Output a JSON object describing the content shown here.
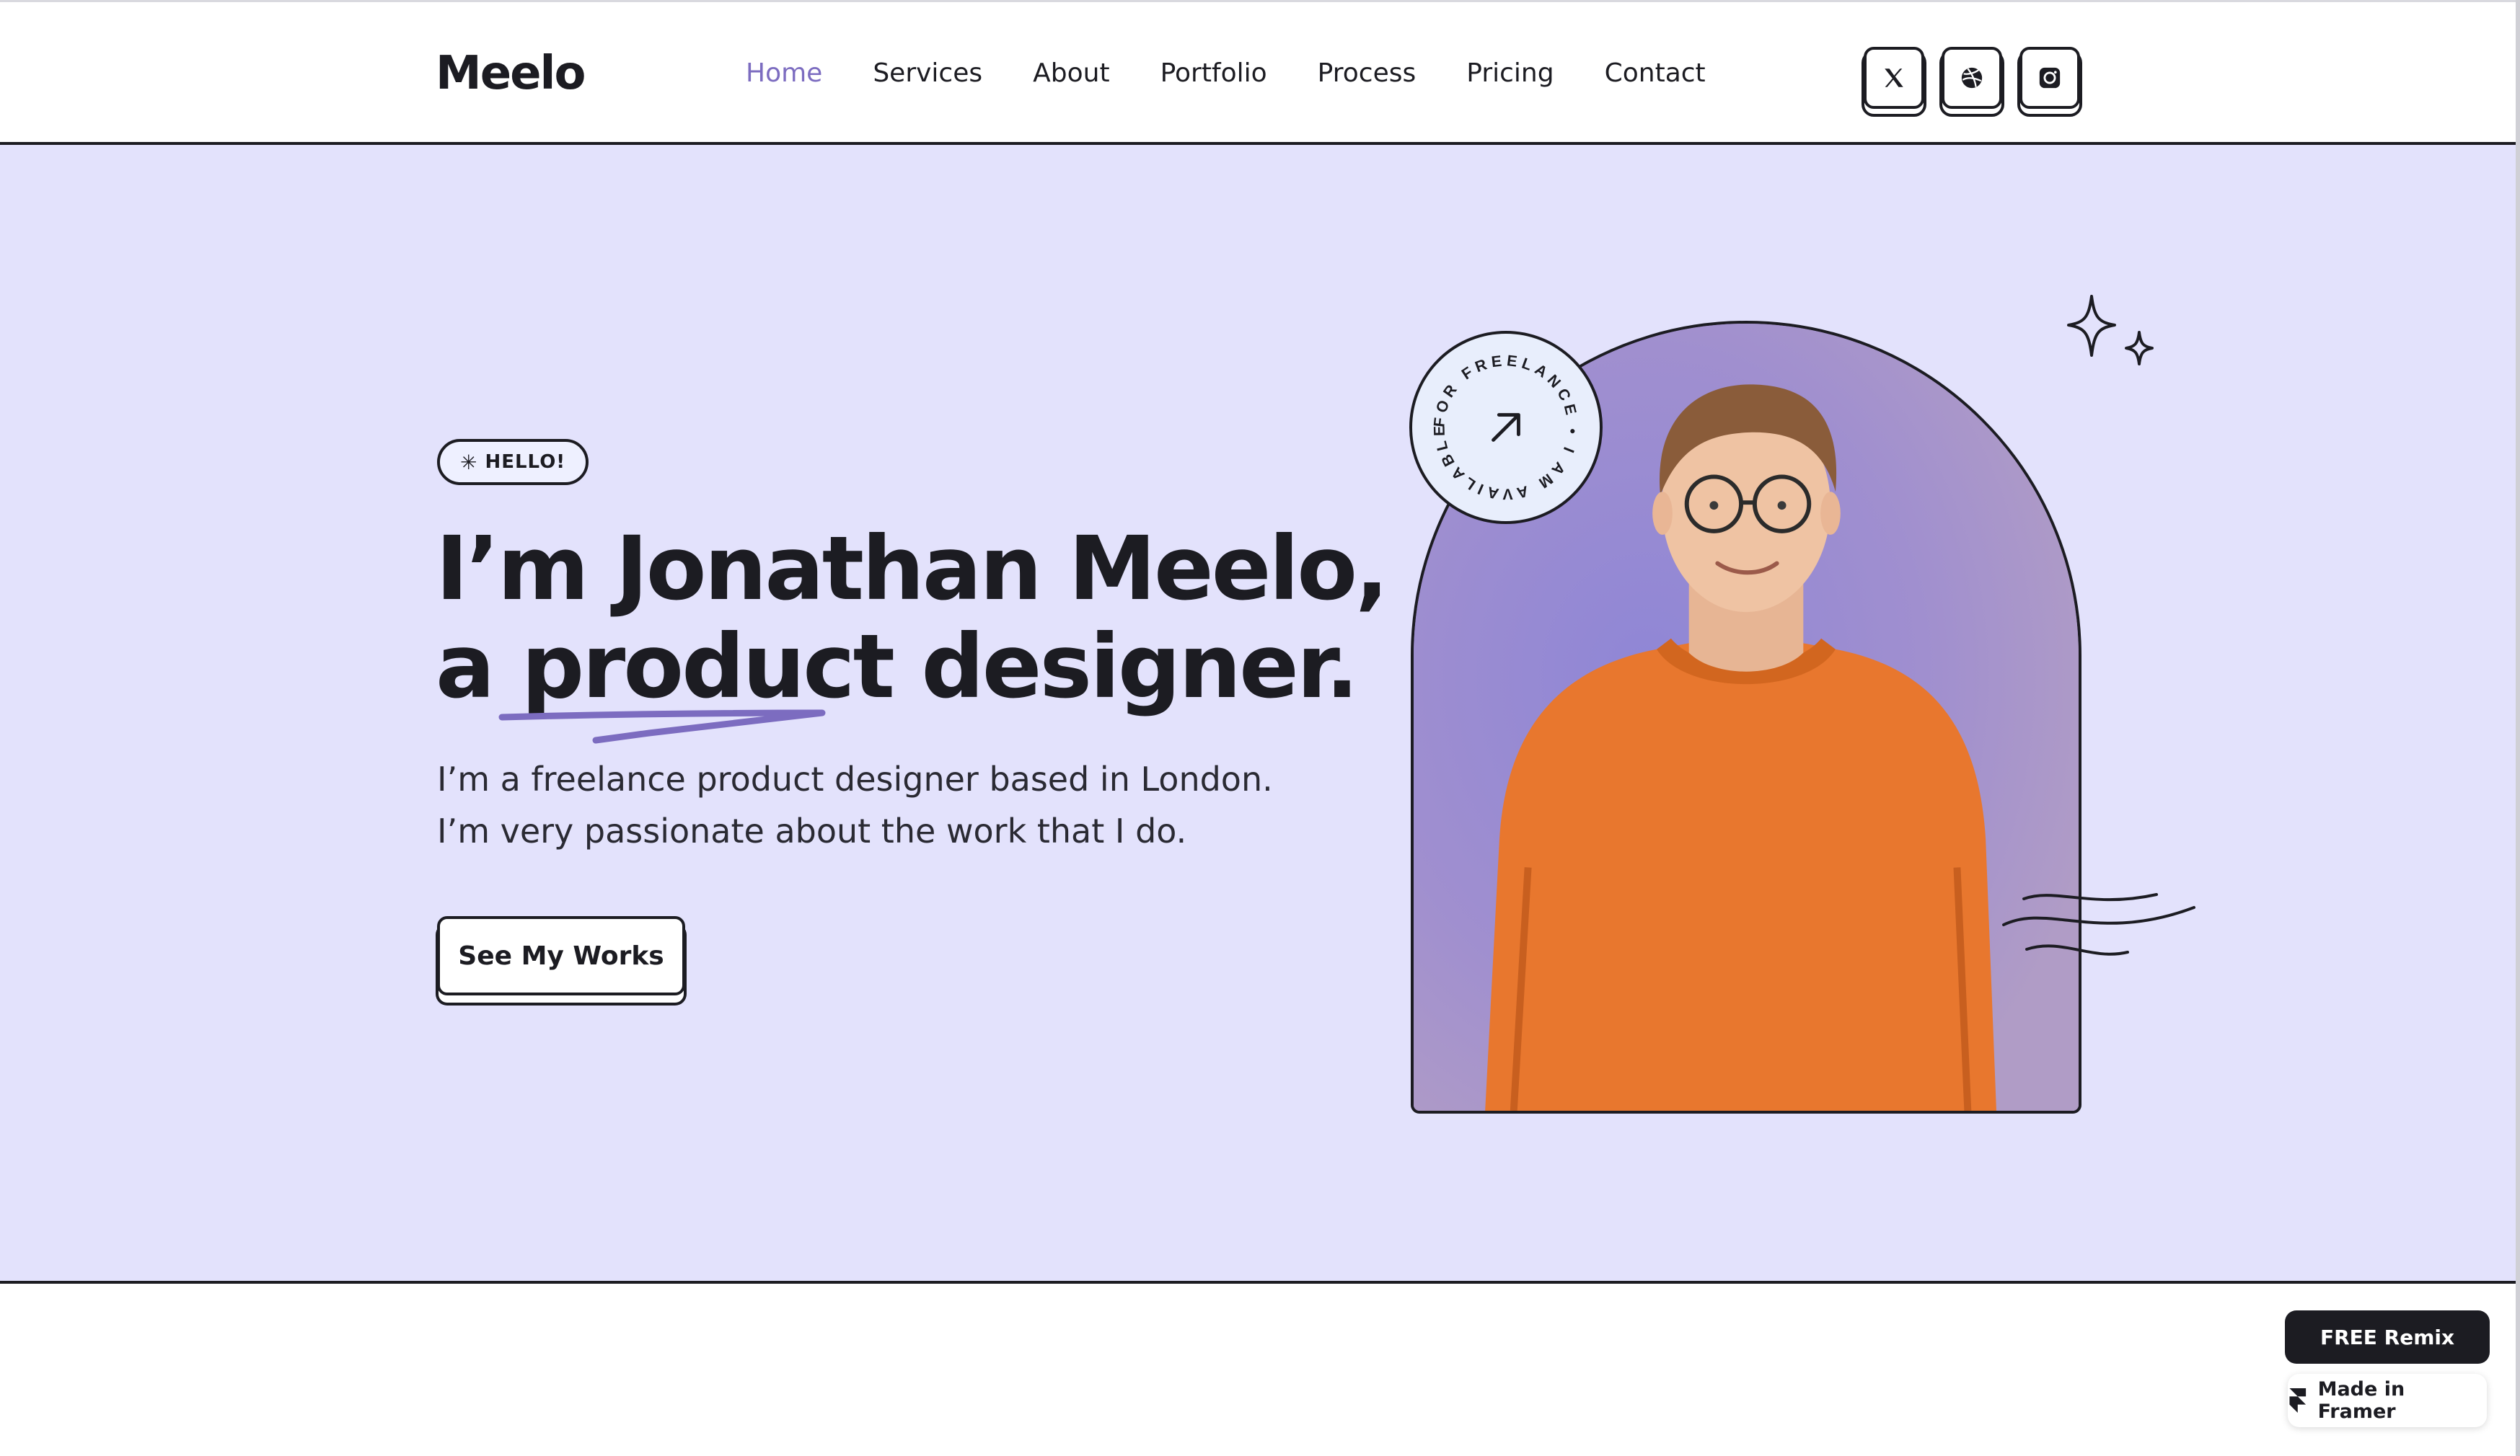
{
  "header": {
    "logo": "Meelo",
    "nav": [
      {
        "label": "Home",
        "active": true
      },
      {
        "label": "Services",
        "active": false
      },
      {
        "label": "About",
        "active": false
      },
      {
        "label": "Portfolio",
        "active": false
      },
      {
        "label": "Process",
        "active": false
      },
      {
        "label": "Pricing",
        "active": false
      },
      {
        "label": "Contact",
        "active": false
      }
    ],
    "socials": [
      {
        "icon": "x-twitter-icon"
      },
      {
        "icon": "dribbble-icon"
      },
      {
        "icon": "instagram-icon"
      }
    ]
  },
  "hero": {
    "badge": "HELLO!",
    "badge_icon": "asterisk-icon",
    "headline_line1": "I’m Jonathan Meelo,",
    "headline_line2_a": "a ",
    "headline_line2_b": "product",
    "headline_line2_c": " designer.",
    "intro_line1": "I’m a freelance product designer based in London.",
    "intro_line2": "I’m very passionate about the work that I do.",
    "cta": "See My Works",
    "freelance_badge_text": "FOR FREELANCE • I AM AVAILABLE •",
    "freelance_badge_icon": "arrow-up-right-icon"
  },
  "floating": {
    "remix": "FREE Remix",
    "framer": "Made in Framer"
  },
  "colors": {
    "hero_bg": "#e3e2fc",
    "accent": "#7c6cc0",
    "ink": "#1c1c22",
    "portrait_bg": "#a595cc",
    "sweater": "#e8772e"
  }
}
